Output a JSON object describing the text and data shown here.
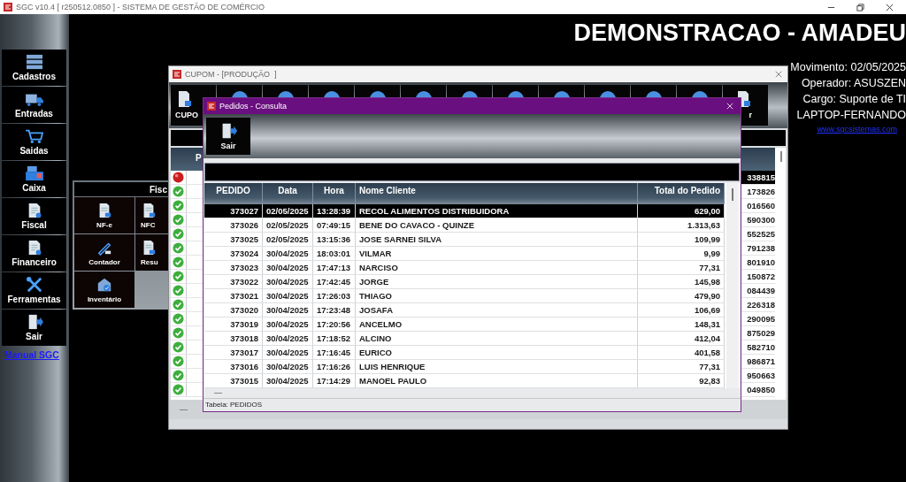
{
  "window": {
    "title": "SGC v10.4 [ r250512.0850 ] - SISTEMA DE GESTÃO DE COMÉRCIO"
  },
  "sidebar": {
    "items": [
      {
        "label": "Cadastros"
      },
      {
        "label": "Entradas"
      },
      {
        "label": "Saidas"
      },
      {
        "label": "Caixa"
      },
      {
        "label": "Fiscal"
      },
      {
        "label": "Financeiro"
      },
      {
        "label": "Ferramentas"
      },
      {
        "label": "Sair"
      }
    ],
    "link": "Manual SGC"
  },
  "banner": "DEMONSTRACAO - AMADEU",
  "session_info": {
    "lines": [
      "Movimento: 02/05/2025",
      "Operador: ASUSZEN",
      "Cargo: Suporte de TI",
      "LAPTOP-FERNANDO"
    ],
    "link": "www.sgcsistemas.com"
  },
  "fiscal_panel": {
    "title": "Fisc",
    "buttons": [
      "NF-e",
      "NFC",
      "Contador",
      "Resu",
      "Inventário"
    ]
  },
  "cupom_window": {
    "title": "CUPOM - [PRODUÇÃO  ]",
    "toolbar": [
      {
        "kind": "labeled",
        "label": "CUPO"
      },
      {
        "kind": "icon"
      },
      {
        "kind": "icon"
      },
      {
        "kind": "icon"
      },
      {
        "kind": "icon"
      },
      {
        "kind": "icon"
      },
      {
        "kind": "icon"
      },
      {
        "kind": "icon"
      },
      {
        "kind": "icon"
      },
      {
        "kind": "icon"
      },
      {
        "kind": "icon"
      },
      {
        "kind": "icon"
      },
      {
        "kind": "labeled",
        "label": "r"
      }
    ],
    "column_2": "P",
    "rows": [
      {
        "ok": false,
        "selected": true,
        "column_3": "338815"
      },
      {
        "ok": true,
        "selected": false,
        "column_3": "173826"
      },
      {
        "ok": true,
        "selected": false,
        "column_3": "016560"
      },
      {
        "ok": true,
        "selected": false,
        "column_3": "590300"
      },
      {
        "ok": true,
        "selected": false,
        "column_3": "552525"
      },
      {
        "ok": true,
        "selected": false,
        "column_3": "791238"
      },
      {
        "ok": true,
        "selected": false,
        "column_3": "801910"
      },
      {
        "ok": true,
        "selected": false,
        "column_3": "150872"
      },
      {
        "ok": true,
        "selected": false,
        "column_3": "084439"
      },
      {
        "ok": true,
        "selected": false,
        "column_3": "226318"
      },
      {
        "ok": true,
        "selected": false,
        "column_3": "290095"
      },
      {
        "ok": true,
        "selected": false,
        "column_3": "875029"
      },
      {
        "ok": true,
        "selected": false,
        "column_3": "582710"
      },
      {
        "ok": true,
        "selected": false,
        "column_3": "986871"
      },
      {
        "ok": true,
        "selected": false,
        "column_3": "950663"
      },
      {
        "ok": true,
        "selected": false,
        "column_3": "049850"
      }
    ],
    "footer_mark": "—"
  },
  "pedidos_window": {
    "title": "Pedidos - Consulta",
    "toolbar": [
      "Sair"
    ],
    "columns": [
      "PEDIDO",
      "Data",
      "Hora",
      "Nome Cliente",
      "Total do Pedido"
    ],
    "rows": [
      {
        "selected": true,
        "cells": [
          "373027",
          "02/05/2025",
          "13:28:39",
          "RECOL ALIMENTOS DISTRIBUIDORA",
          "629,00"
        ]
      },
      {
        "selected": false,
        "cells": [
          "373026",
          "02/05/2025",
          "07:49:15",
          "BENE DO CAVACO - QUINZE",
          "1.313,63"
        ]
      },
      {
        "selected": false,
        "cells": [
          "373025",
          "02/05/2025",
          "13:15:36",
          "JOSE SARNEI SILVA",
          "109,99"
        ]
      },
      {
        "selected": false,
        "cells": [
          "373024",
          "30/04/2025",
          "18:03:01",
          "VILMAR",
          "9,99"
        ]
      },
      {
        "selected": false,
        "cells": [
          "373023",
          "30/04/2025",
          "17:47:13",
          "NARCISO",
          "77,31"
        ]
      },
      {
        "selected": false,
        "cells": [
          "373022",
          "30/04/2025",
          "17:42:45",
          "JORGE",
          "145,98"
        ]
      },
      {
        "selected": false,
        "cells": [
          "373021",
          "30/04/2025",
          "17:26:03",
          "THIAGO",
          "479,90"
        ]
      },
      {
        "selected": false,
        "cells": [
          "373020",
          "30/04/2025",
          "17:23:48",
          "JOSAFA",
          "106,69"
        ]
      },
      {
        "selected": false,
        "cells": [
          "373019",
          "30/04/2025",
          "17:20:56",
          "ANCELMO",
          "148,31"
        ]
      },
      {
        "selected": false,
        "cells": [
          "373018",
          "30/04/2025",
          "17:18:52",
          "ALCINO",
          "412,04"
        ]
      },
      {
        "selected": false,
        "cells": [
          "373017",
          "30/04/2025",
          "17:16:45",
          "EURICO",
          "401,58"
        ]
      },
      {
        "selected": false,
        "cells": [
          "373016",
          "30/04/2025",
          "17:16:26",
          "LUIS HENRIQUE",
          "77,31"
        ]
      },
      {
        "selected": false,
        "cells": [
          "373015",
          "30/04/2025",
          "17:14:29",
          "MANOEL PAULO",
          "92,83"
        ]
      }
    ],
    "footer_mark": "—",
    "status_bar": "Tabela: PEDIDOS"
  }
}
